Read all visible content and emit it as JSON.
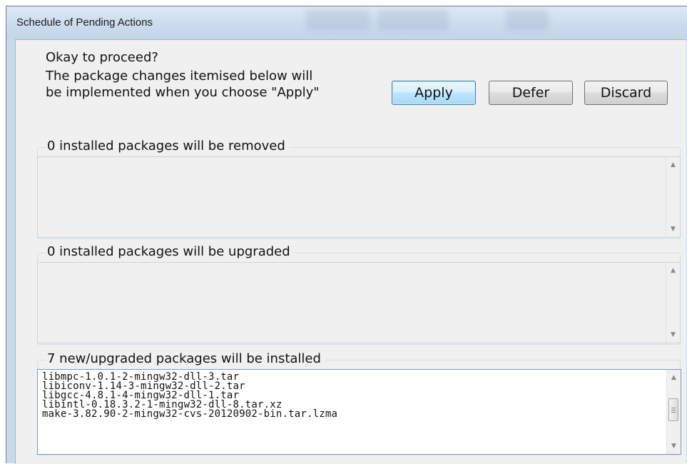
{
  "window": {
    "title": "Schedule of Pending Actions"
  },
  "prompt": {
    "heading": "Okay to proceed?",
    "line1": "The package changes itemised below will",
    "line2": "be implemented when you choose \"Apply\""
  },
  "buttons": {
    "apply": "Apply",
    "defer": "Defer",
    "discard": "Discard"
  },
  "sections": {
    "removed": {
      "label": "0 installed packages will be removed",
      "items": []
    },
    "upgraded": {
      "label": "0 installed packages will be upgraded",
      "items": []
    },
    "installed": {
      "label": "7 new/upgraded packages will be installed",
      "items": [
        "libmpc-1.0.1-2-mingw32-dll-3.tar",
        "libiconv-1.14-3-mingw32-dll-2.tar",
        "libgcc-4.8.1-4-mingw32-dll-1.tar",
        "libintl-0.18.3.2-1-mingw32-dll-8.tar.xz",
        "make-3.82.90-2-mingw32-cvs-20120902-bin.tar.lzma"
      ]
    }
  },
  "icons": {
    "scroll_up": "scroll-up-arrow-icon",
    "scroll_down": "scroll-down-arrow-icon",
    "thumb_grip": "scrollbar-grip-icon"
  }
}
